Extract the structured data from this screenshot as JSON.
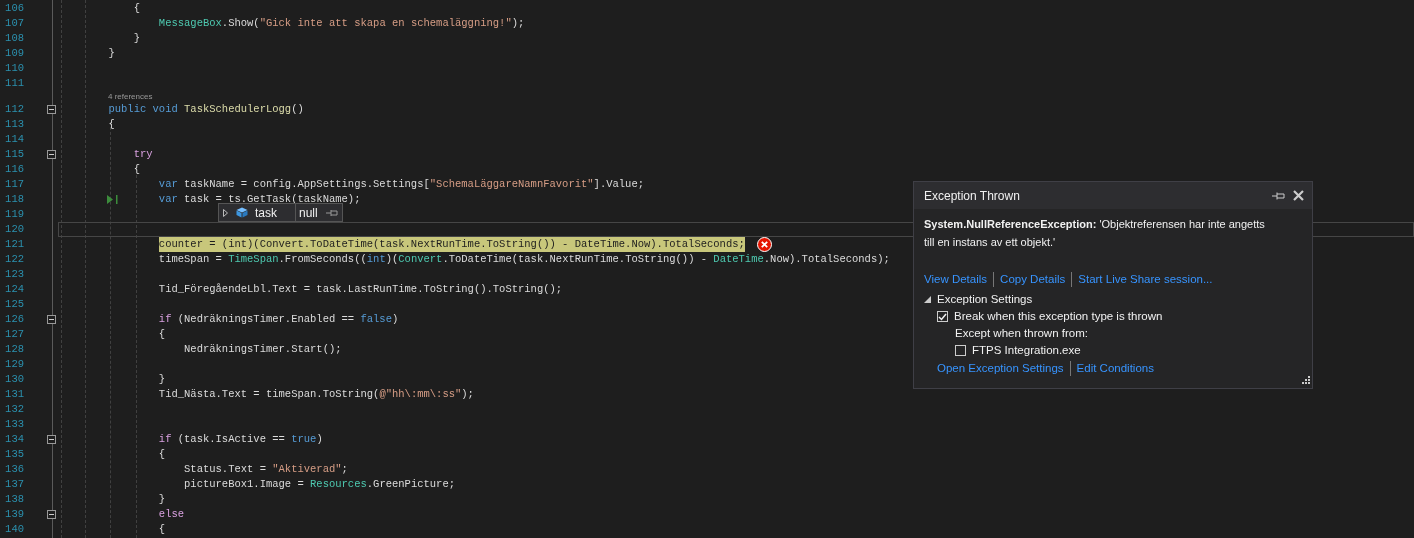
{
  "editor": {
    "lines": [
      {
        "number": "106",
        "tokens": [
          {
            "kind": "plain",
            "text": "            {"
          }
        ]
      },
      {
        "number": "107",
        "tokens": [
          {
            "kind": "type",
            "text": "                MessageBox"
          },
          {
            "kind": "plain",
            "text": ".Show("
          },
          {
            "kind": "str",
            "text": "\"Gick inte att skapa en schemaläggning!\""
          },
          {
            "kind": "plain",
            "text": ");"
          }
        ]
      },
      {
        "number": "108",
        "tokens": [
          {
            "kind": "plain",
            "text": "            }"
          }
        ]
      },
      {
        "number": "109",
        "tokens": [
          {
            "kind": "plain",
            "text": "        }"
          }
        ]
      },
      {
        "number": "110"
      },
      {
        "number": "111"
      },
      {
        "number": "112",
        "codelens": "4 references",
        "foldable": true,
        "tokens": [
          {
            "kind": "kw",
            "text": "        public"
          },
          {
            "kind": "kw",
            "text": " void"
          },
          {
            "kind": "method",
            "text": " TaskSchedulerLogg"
          },
          {
            "kind": "plain",
            "text": "()"
          }
        ]
      },
      {
        "number": "113",
        "tokens": [
          {
            "kind": "plain",
            "text": "        {"
          }
        ]
      },
      {
        "number": "114"
      },
      {
        "number": "115",
        "foldable": true,
        "tokens": [
          {
            "kind": "ctl",
            "text": "            try"
          }
        ]
      },
      {
        "number": "116",
        "tokens": [
          {
            "kind": "plain",
            "text": "            {"
          }
        ]
      },
      {
        "number": "117",
        "tokens": [
          {
            "kind": "kw",
            "text": "                var"
          },
          {
            "kind": "plain",
            "text": " taskName = config.AppSettings.Settings["
          },
          {
            "kind": "str",
            "text": "\"SchemaLäggareNamnFavorit\""
          },
          {
            "kind": "plain",
            "text": "].Value;"
          }
        ]
      },
      {
        "number": "118",
        "run_to_click": true,
        "tokens": [
          {
            "kind": "kw",
            "text": "                var"
          },
          {
            "kind": "plain",
            "text": " task = ts.GetTask(taskName);"
          }
        ]
      },
      {
        "number": "119"
      },
      {
        "number": "120",
        "current": true
      },
      {
        "number": "121",
        "next_statement": true,
        "error": true,
        "tokens": [
          {
            "kind": "plain",
            "text": "                counter = (int)(Convert.ToDateTime(task.NextRunTime.ToString()) - DateTime.Now).TotalSeconds;"
          }
        ]
      },
      {
        "number": "122",
        "tokens": [
          {
            "kind": "plain",
            "text": "                timeSpan = "
          },
          {
            "kind": "type",
            "text": "TimeSpan"
          },
          {
            "kind": "plain",
            "text": ".FromSeconds(("
          },
          {
            "kind": "kw",
            "text": "int"
          },
          {
            "kind": "plain",
            "text": ")("
          },
          {
            "kind": "type",
            "text": "Convert"
          },
          {
            "kind": "plain",
            "text": ".ToDateTime(task.NextRunTime.ToString()) - "
          },
          {
            "kind": "type",
            "text": "DateTime"
          },
          {
            "kind": "plain",
            "text": ".Now).TotalSeconds);"
          }
        ]
      },
      {
        "number": "123"
      },
      {
        "number": "124",
        "tokens": [
          {
            "kind": "plain",
            "text": "                Tid_FöregåendeLbl.Text = task.LastRunTime.ToString().ToString();"
          }
        ]
      },
      {
        "number": "125"
      },
      {
        "number": "126",
        "foldable": true,
        "tokens": [
          {
            "kind": "ctl",
            "text": "                if"
          },
          {
            "kind": "plain",
            "text": " (NedräkningsTimer.Enabled == "
          },
          {
            "kind": "kw",
            "text": "false"
          },
          {
            "kind": "plain",
            "text": ")"
          }
        ]
      },
      {
        "number": "127",
        "tokens": [
          {
            "kind": "plain",
            "text": "                {"
          }
        ]
      },
      {
        "number": "128",
        "tokens": [
          {
            "kind": "plain",
            "text": "                    NedräkningsTimer.Start();"
          }
        ]
      },
      {
        "number": "129"
      },
      {
        "number": "130",
        "tokens": [
          {
            "kind": "plain",
            "text": "                }"
          }
        ]
      },
      {
        "number": "131",
        "tokens": [
          {
            "kind": "plain",
            "text": "                Tid_Nästa.Text = timeSpan.ToString("
          },
          {
            "kind": "str",
            "text": "@\"hh\\:mm\\:ss\""
          },
          {
            "kind": "plain",
            "text": ");"
          }
        ]
      },
      {
        "number": "132"
      },
      {
        "number": "133"
      },
      {
        "number": "134",
        "foldable": true,
        "tokens": [
          {
            "kind": "ctl",
            "text": "                if"
          },
          {
            "kind": "plain",
            "text": " (task.IsActive == "
          },
          {
            "kind": "kw",
            "text": "true"
          },
          {
            "kind": "plain",
            "text": ")"
          }
        ]
      },
      {
        "number": "135",
        "tokens": [
          {
            "kind": "plain",
            "text": "                {"
          }
        ]
      },
      {
        "number": "136",
        "tokens": [
          {
            "kind": "plain",
            "text": "                    Status.Text = "
          },
          {
            "kind": "str",
            "text": "\"Aktiverad\""
          },
          {
            "kind": "plain",
            "text": ";"
          }
        ]
      },
      {
        "number": "137",
        "tokens": [
          {
            "kind": "plain",
            "text": "                    pictureBox1.Image = "
          },
          {
            "kind": "type",
            "text": "Resources"
          },
          {
            "kind": "plain",
            "text": ".GreenPicture;"
          }
        ]
      },
      {
        "number": "138",
        "tokens": [
          {
            "kind": "plain",
            "text": "                }"
          }
        ]
      },
      {
        "number": "139",
        "foldable": true,
        "tokens": [
          {
            "kind": "ctl",
            "text": "                else"
          }
        ]
      },
      {
        "number": "140",
        "tokens": [
          {
            "kind": "plain",
            "text": "                {"
          }
        ]
      }
    ]
  },
  "datatip": {
    "name": "task",
    "value": "null",
    "expanded": false
  },
  "exception_popup": {
    "title": "Exception Thrown",
    "message": "**System.NullReferenceException:** 'Objektreferensen har inte angetts till en instans av ett objekt.'",
    "links": [
      "View Details",
      "Copy Details",
      "Start Live Share session..."
    ],
    "settings": {
      "title": "Exception Settings",
      "expanded": true,
      "break_option": {
        "label": "Break when this exception type is thrown",
        "checked": true
      },
      "except_label": "Except when thrown from:",
      "modules": [
        {
          "label": "FTPS Integration.exe",
          "checked": false
        }
      ]
    },
    "footer_links": [
      "Open Exception Settings",
      "Edit Conditions"
    ]
  }
}
